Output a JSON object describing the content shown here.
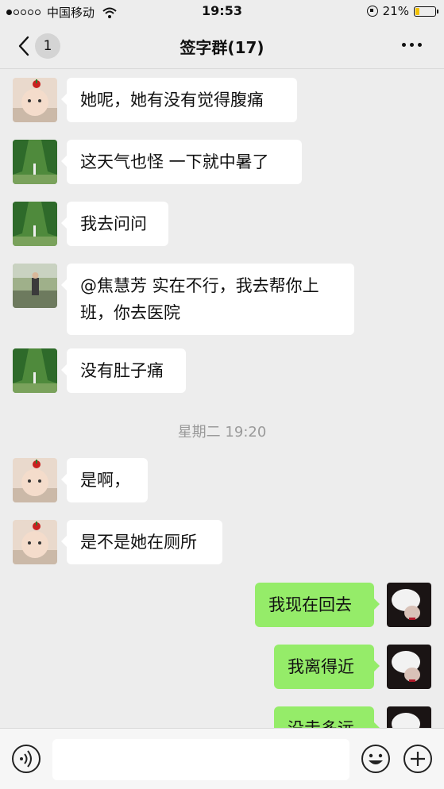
{
  "status_bar": {
    "carrier": "中国移动",
    "time": "19:53",
    "battery": "21%",
    "battery_level": 0.21,
    "icons": [
      "signal-dots",
      "wifi-icon",
      "orientation-lock-icon",
      "battery-icon"
    ]
  },
  "nav": {
    "back_badge": "1",
    "title": "签字群(17)",
    "icons": [
      "back-chevron-icon",
      "more-icon"
    ]
  },
  "messages": [
    {
      "side": "left",
      "avatar": "baby-avatar",
      "text": "她呢，她有没有觉得腹痛"
    },
    {
      "side": "left",
      "avatar": "landscape-avatar",
      "text": "这天气也怪 一下就中暑了"
    },
    {
      "side": "left",
      "avatar": "landscape-avatar",
      "text": "我去问问"
    },
    {
      "side": "left",
      "avatar": "person-lake-avatar",
      "text": "@焦慧芳 实在不行，我去帮你上班，你去医院"
    },
    {
      "side": "left",
      "avatar": "landscape-avatar",
      "text": "没有肚子痛"
    },
    {
      "side": "left",
      "avatar": "baby-avatar",
      "text": "是啊，"
    },
    {
      "side": "left",
      "avatar": "baby-avatar",
      "text": "是不是她在厕所"
    },
    {
      "side": "right",
      "avatar": "dark-portrait-avatar",
      "text": "我现在回去"
    },
    {
      "side": "right",
      "avatar": "dark-portrait-avatar",
      "text": "我离得近"
    },
    {
      "side": "right",
      "avatar": "dark-portrait-avatar",
      "text": "没走多远"
    }
  ],
  "timestamp": "星期二 19:20",
  "input_bar": {
    "value": "",
    "icons": [
      "voice-icon",
      "emoji-icon",
      "add-icon"
    ]
  },
  "colors": {
    "background": "#ededed",
    "incoming_bubble": "#ffffff",
    "outgoing_bubble": "#95ec69",
    "battery_fill": "#f2c100"
  }
}
